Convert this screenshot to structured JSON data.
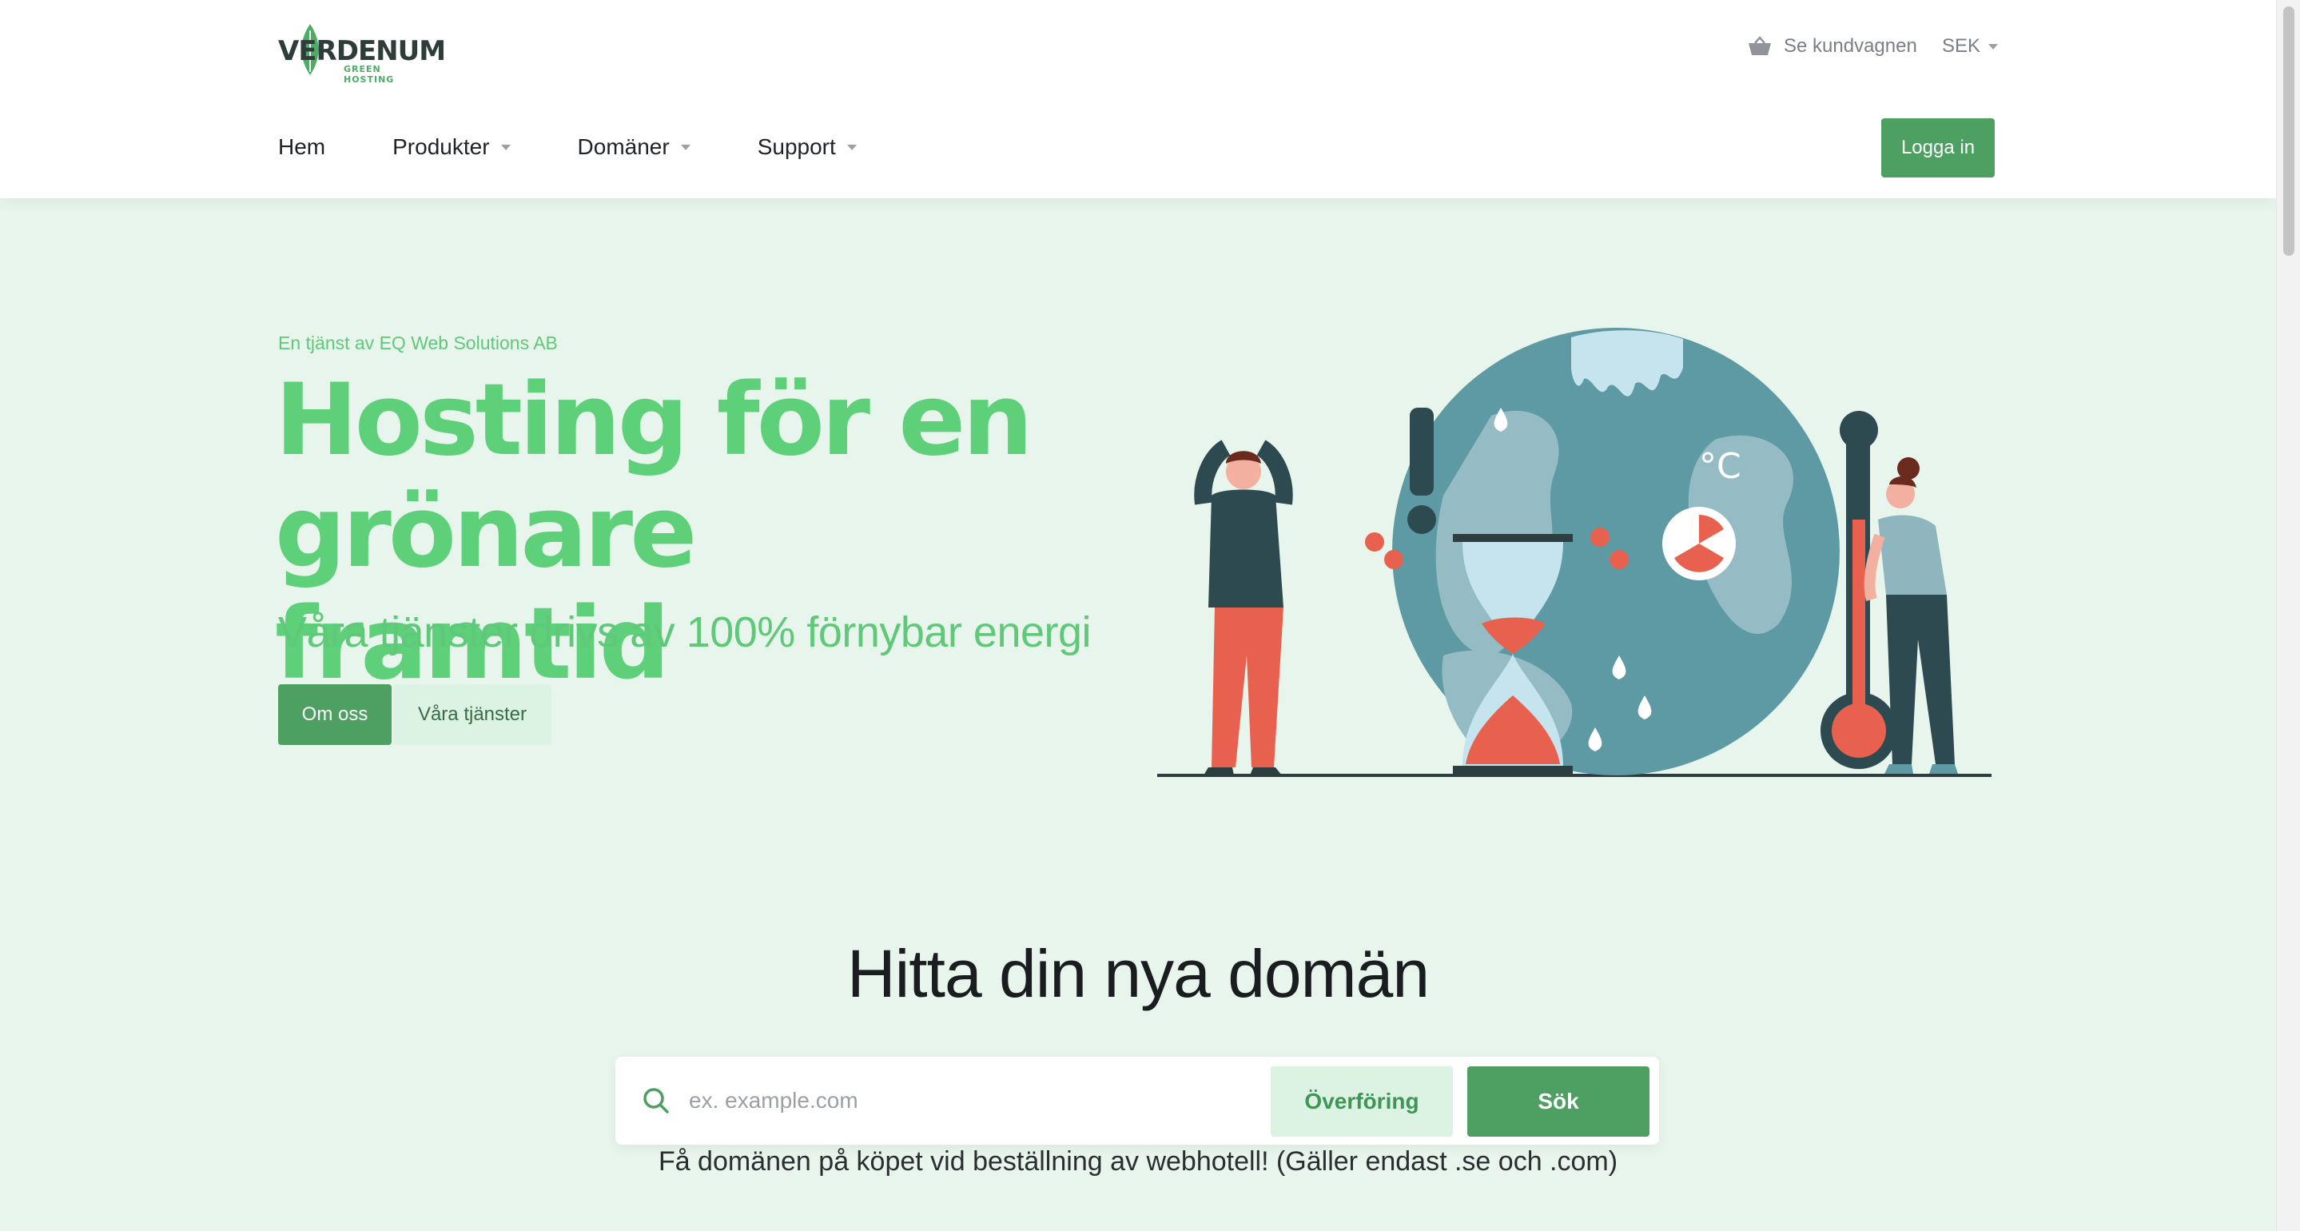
{
  "brand": {
    "logo_text": "VERDENUM",
    "logo_subtext": "GREEN HOSTING"
  },
  "header": {
    "cart_label": "Se kundvagnen",
    "currency": "SEK",
    "login_label": "Logga in"
  },
  "nav": {
    "items": [
      {
        "label": "Hem",
        "dropdown": false
      },
      {
        "label": "Produkter",
        "dropdown": true
      },
      {
        "label": "Domäner",
        "dropdown": true
      },
      {
        "label": "Support",
        "dropdown": true
      }
    ]
  },
  "hero": {
    "tagline": "En tjänst av EQ Web Solutions AB",
    "title_line1": "Hosting för en",
    "title_line2": "grönare framtid",
    "subtitle": "Våra tjänster drivs av 100% förnybar energi",
    "primary_button": "Om oss",
    "secondary_button": "Våra tjänster"
  },
  "domain_search": {
    "title": "Hitta din nya domän",
    "placeholder": "ex. example.com",
    "transfer_button": "Överföring",
    "search_button": "Sök",
    "note": "Få domänen på köpet vid beställning av webhotell! (Gäller endast .se och .com)"
  },
  "colors": {
    "brand_green": "#4e9f62",
    "hero_green": "#5fd07a",
    "hero_background": "#e8f5ec"
  },
  "icons": [
    "leaf-logo-icon",
    "basket-icon",
    "chevron-down-icon",
    "search-icon"
  ]
}
